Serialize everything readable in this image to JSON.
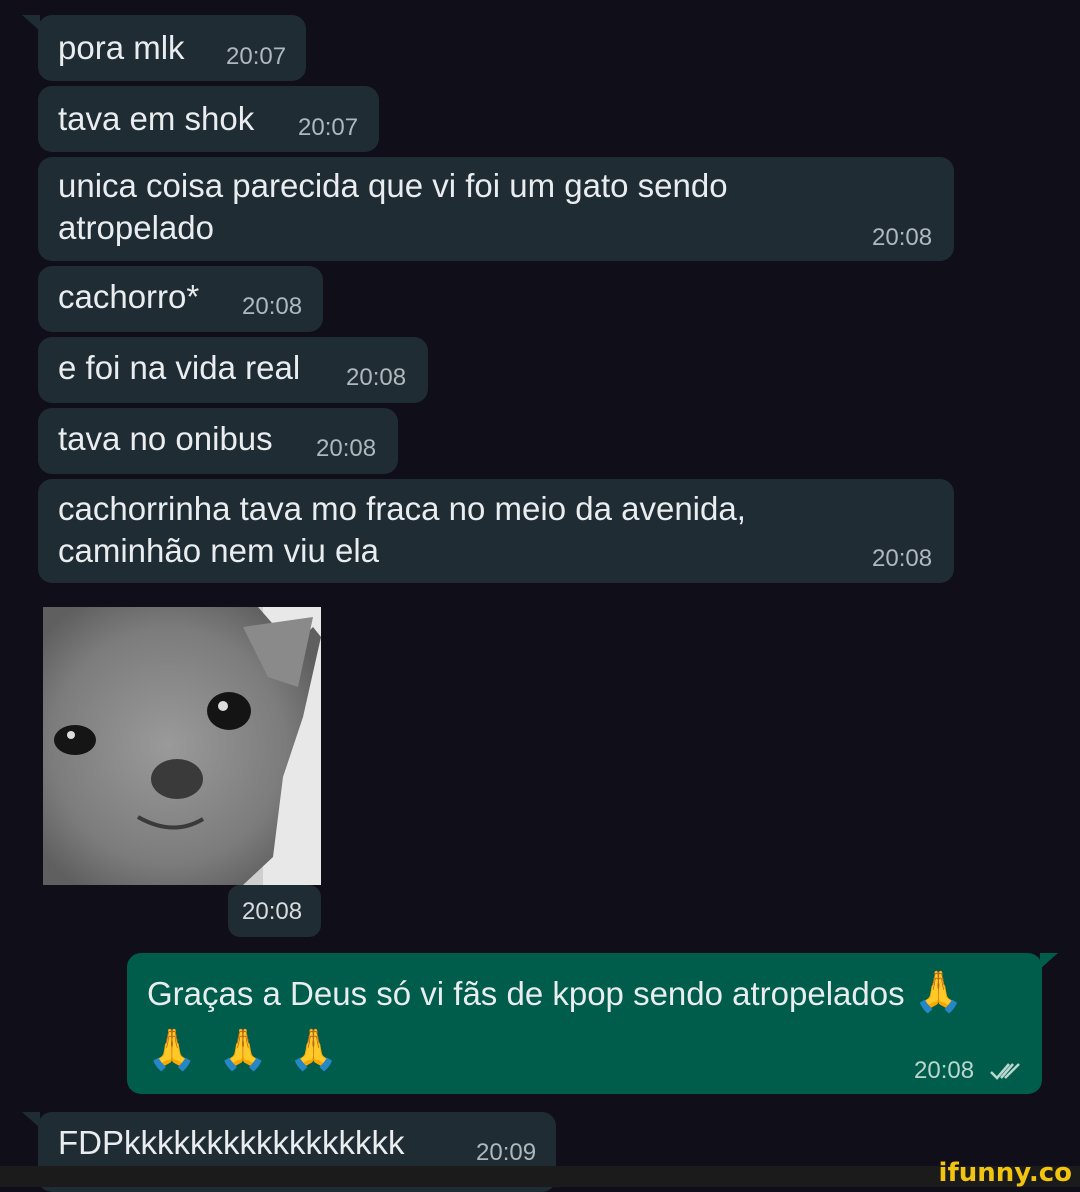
{
  "messages": [
    {
      "text": "pora mlk",
      "time": "20:07"
    },
    {
      "text": "tava em shok",
      "time": "20:07"
    },
    {
      "text": "unica coisa parecida que vi foi um gato sendo\natropelado",
      "time": "20:08"
    },
    {
      "text": "cachorro*",
      "time": "20:08"
    },
    {
      "text": "e foi na vida real",
      "time": "20:08"
    },
    {
      "text": "tava no onibus",
      "time": "20:08"
    },
    {
      "text": "cachorrinha tava mo fraca no meio da avenida,\ncaminhão nem viu ela",
      "time": "20:08"
    },
    {
      "text": "FDPkkkkkkkkkkkkkkkkk",
      "time": "20:09"
    }
  ],
  "sticker": {
    "time": "20:08",
    "description_icon": "chihuahua-sticker"
  },
  "outgoing": {
    "line1": "Graças a Deus só vi fãs de kpop sendo atropelados",
    "emoji": "🙏",
    "time": "20:08",
    "status_icon": "double-check-icon"
  },
  "watermark": "ifunny.co"
}
